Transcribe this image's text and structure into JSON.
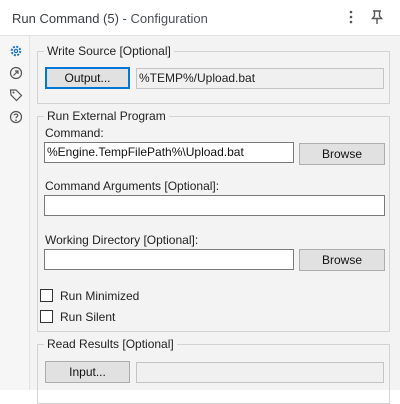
{
  "window": {
    "tool_name": "Run Command (5)",
    "panel_name": " - Configuration"
  },
  "sidebar": {
    "items": [
      {
        "icon": "gear-icon"
      },
      {
        "icon": "arrow-circle-icon"
      },
      {
        "icon": "tag-icon"
      },
      {
        "icon": "help-icon"
      }
    ]
  },
  "write_source": {
    "legend": "Write Source [Optional]",
    "button_label": "Output...",
    "value": "%TEMP%/Upload.bat"
  },
  "run_external": {
    "legend": "Run External Program",
    "command_label": "Command:",
    "command_value": "%Engine.TempFilePath%\\Upload.bat",
    "command_browse_label": "Browse",
    "arguments_label": "Command Arguments [Optional]:",
    "arguments_value": "",
    "working_dir_label": "Working Directory [Optional]:",
    "working_dir_value": "",
    "working_dir_browse_label": "Browse"
  },
  "options": {
    "run_minimized_label": "Run Minimized",
    "run_minimized_checked": false,
    "run_silent_label": "Run Silent",
    "run_silent_checked": false
  },
  "read_results": {
    "legend": "Read Results [Optional]",
    "button_label": "Input...",
    "value": ""
  }
}
